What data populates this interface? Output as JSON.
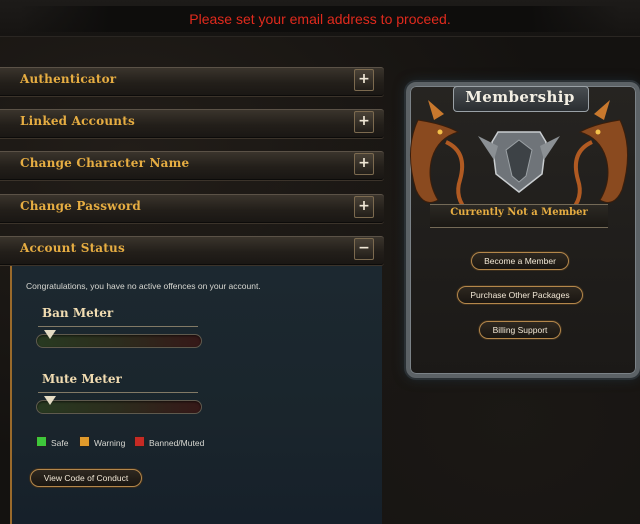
{
  "alert": {
    "message": "Please set your email address to proceed."
  },
  "accordion": [
    {
      "label": "Authenticator",
      "toggle": "+"
    },
    {
      "label": "Linked Accounts",
      "toggle": "+"
    },
    {
      "label": "Change Character Name",
      "toggle": "+"
    },
    {
      "label": "Change Password",
      "toggle": "+"
    },
    {
      "label": "Account Status",
      "toggle": "−"
    }
  ],
  "account_status": {
    "message": "Congratulations, you have no active offences on your account.",
    "ban_meter": {
      "title": "Ban Meter",
      "level": 0.0
    },
    "mute_meter": {
      "title": "Mute Meter",
      "level": 0.0
    },
    "legend": [
      {
        "label": "Safe",
        "color": "#3ec63b"
      },
      {
        "label": "Warning",
        "color": "#e09a2b"
      },
      {
        "label": "Banned/Muted",
        "color": "#c62a24"
      }
    ],
    "code_of_conduct_button": "View Code of Conduct"
  },
  "membership": {
    "title": "Membership",
    "status": "Currently Not a Member",
    "buttons": {
      "become": "Become a Member",
      "purchase": "Purchase Other Packages",
      "billing": "Billing Support"
    },
    "icons": [
      "dragon-left-icon",
      "dragon-right-icon",
      "shield-crest-icon"
    ]
  },
  "colors": {
    "accent_gold": "#e6ad42",
    "alert_red": "#e02a1d"
  }
}
